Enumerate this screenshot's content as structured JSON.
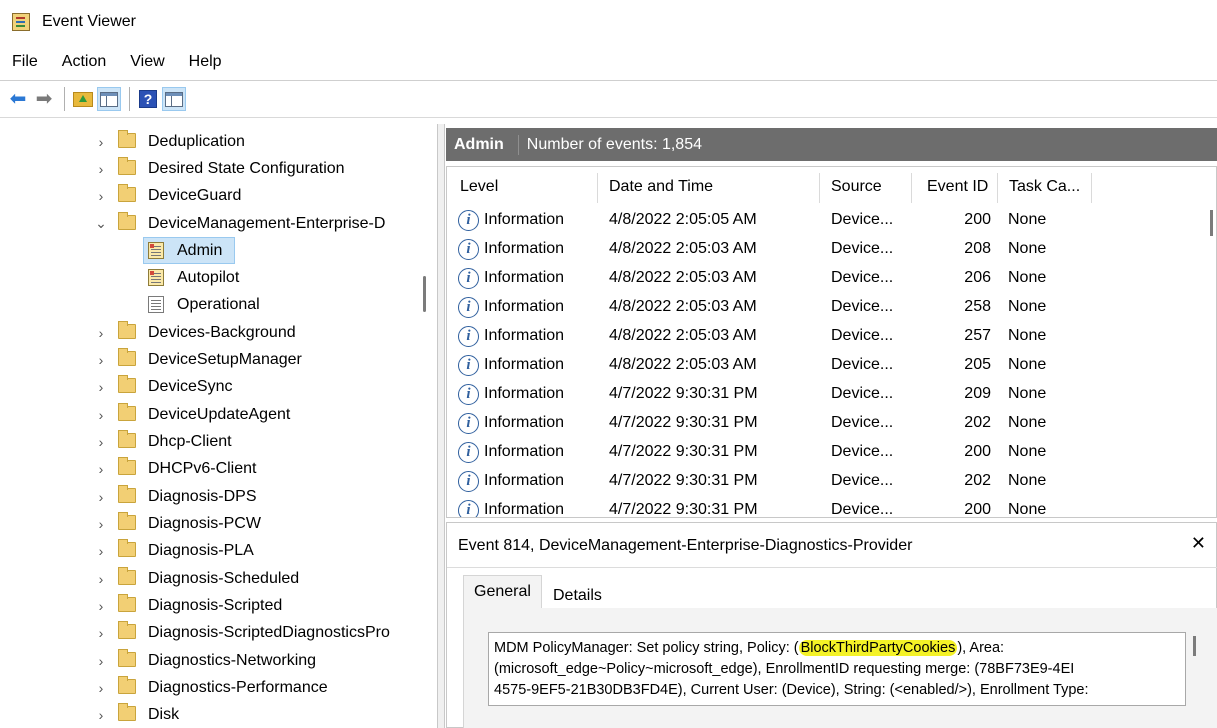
{
  "window": {
    "title": "Event Viewer"
  },
  "menu": [
    "File",
    "Action",
    "View",
    "Help"
  ],
  "tree": {
    "items": [
      {
        "label": "Deduplication"
      },
      {
        "label": "Desired State Configuration"
      },
      {
        "label": "DeviceGuard"
      },
      {
        "label": "DeviceManagement-Enterprise-D",
        "expanded": true
      },
      {
        "label": "Admin",
        "child": true,
        "selected": true
      },
      {
        "label": "Autopilot",
        "child": true
      },
      {
        "label": "Operational",
        "child": true
      },
      {
        "label": "Devices-Background"
      },
      {
        "label": "DeviceSetupManager"
      },
      {
        "label": "DeviceSync"
      },
      {
        "label": "DeviceUpdateAgent"
      },
      {
        "label": "Dhcp-Client"
      },
      {
        "label": "DHCPv6-Client"
      },
      {
        "label": "Diagnosis-DPS"
      },
      {
        "label": "Diagnosis-PCW"
      },
      {
        "label": "Diagnosis-PLA"
      },
      {
        "label": "Diagnosis-Scheduled"
      },
      {
        "label": "Diagnosis-Scripted"
      },
      {
        "label": "Diagnosis-ScriptedDiagnosticsPro"
      },
      {
        "label": "Diagnostics-Networking"
      },
      {
        "label": "Diagnostics-Performance"
      },
      {
        "label": "Disk"
      }
    ]
  },
  "log_header": {
    "title": "Admin",
    "count_text": "Number of events: 1,854"
  },
  "events": {
    "columns": [
      "Level",
      "Date and Time",
      "Source",
      "Event ID",
      "Task Ca..."
    ],
    "rows": [
      {
        "level": "Information",
        "datetime": "4/8/2022 2:05:05 AM",
        "source": "Device...",
        "id": "200",
        "task": "None"
      },
      {
        "level": "Information",
        "datetime": "4/8/2022 2:05:03 AM",
        "source": "Device...",
        "id": "208",
        "task": "None"
      },
      {
        "level": "Information",
        "datetime": "4/8/2022 2:05:03 AM",
        "source": "Device...",
        "id": "206",
        "task": "None"
      },
      {
        "level": "Information",
        "datetime": "4/8/2022 2:05:03 AM",
        "source": "Device...",
        "id": "258",
        "task": "None"
      },
      {
        "level": "Information",
        "datetime": "4/8/2022 2:05:03 AM",
        "source": "Device...",
        "id": "257",
        "task": "None"
      },
      {
        "level": "Information",
        "datetime": "4/8/2022 2:05:03 AM",
        "source": "Device...",
        "id": "205",
        "task": "None"
      },
      {
        "level": "Information",
        "datetime": "4/7/2022 9:30:31 PM",
        "source": "Device...",
        "id": "209",
        "task": "None"
      },
      {
        "level": "Information",
        "datetime": "4/7/2022 9:30:31 PM",
        "source": "Device...",
        "id": "202",
        "task": "None"
      },
      {
        "level": "Information",
        "datetime": "4/7/2022 9:30:31 PM",
        "source": "Device...",
        "id": "200",
        "task": "None"
      },
      {
        "level": "Information",
        "datetime": "4/7/2022 9:30:31 PM",
        "source": "Device...",
        "id": "202",
        "task": "None"
      },
      {
        "level": "Information",
        "datetime": "4/7/2022 9:30:31 PM",
        "source": "Device...",
        "id": "200",
        "task": "None"
      }
    ]
  },
  "detail": {
    "title": "Event 814, DeviceManagement-Enterprise-Diagnostics-Provider",
    "tabs": [
      "General",
      "Details"
    ],
    "message": {
      "line1_pre": "MDM PolicyManager: Set policy string, Policy: (",
      "line1_highlight": "BlockThirdPartyCookies",
      "line1_post": "), Area:",
      "line2": "(microsoft_edge~Policy~microsoft_edge), EnrollmentID requesting merge: (78BF73E9-4EI",
      "line3": "4575-9EF5-21B30DB3FD4E), Current User: (Device), String: (<enabled/>), Enrollment Type:"
    }
  },
  "colors": {
    "header_bar": "#6d6d6d",
    "selection": "#cce4f7",
    "highlight": "#f4f227",
    "info_icon": "#2f5f9e"
  },
  "icons": [
    "app-icon",
    "back-arrow-icon",
    "forward-arrow-icon",
    "folder-up-icon",
    "show-hide-tree-icon",
    "help-icon",
    "action-pane-icon",
    "folder-icon",
    "log-icon",
    "information-icon",
    "close-icon"
  ]
}
